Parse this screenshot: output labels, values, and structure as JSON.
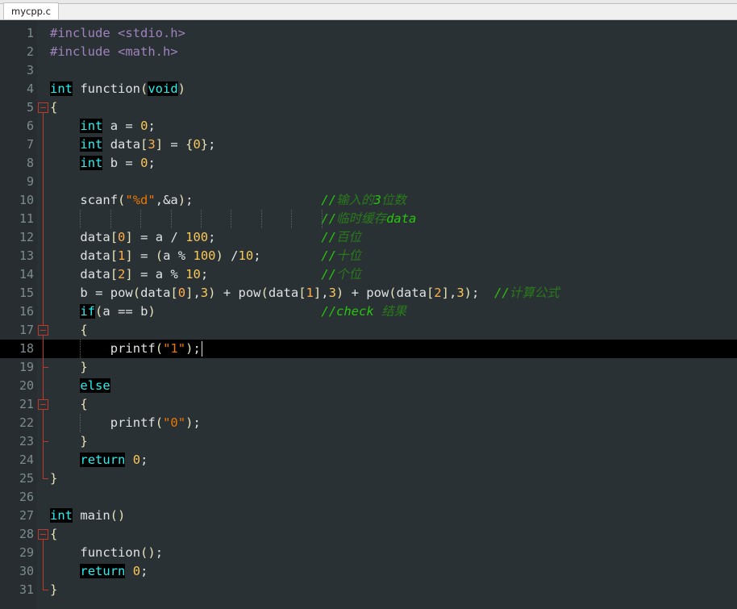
{
  "window": {
    "tab_label": "mycpp.c"
  },
  "editor": {
    "theme": {
      "background": "#293134",
      "gutter_background": "#272d30",
      "line_number_color": "#7d8c8f",
      "current_line_background": "#000000",
      "keyword_color": "#29f0f0",
      "keyword_background": "#000000",
      "string_color": "#ec7600",
      "number_color": "#f9c859",
      "comment_color": "#2a7a1c",
      "bracket_color": "#e8e2b7",
      "text_color": "#e0e2e4",
      "preprocessor_color": "#a082bd",
      "fold_marker_color": "#c0392b"
    },
    "current_line": 18,
    "total_lines": 31,
    "lines": [
      {
        "n": 1,
        "text": "#include <stdio.h>"
      },
      {
        "n": 2,
        "text": "#include <math.h>"
      },
      {
        "n": 3,
        "text": ""
      },
      {
        "n": 4,
        "text": "int function(void)"
      },
      {
        "n": 5,
        "text": "{"
      },
      {
        "n": 6,
        "text": "    int a = 0;"
      },
      {
        "n": 7,
        "text": "    int data[3] = {0};"
      },
      {
        "n": 8,
        "text": "    int b = 0;"
      },
      {
        "n": 9,
        "text": ""
      },
      {
        "n": 10,
        "text": "    scanf(\"%d\",&a);                 //输入的3位数"
      },
      {
        "n": 11,
        "text": "                                    //临时缓存data"
      },
      {
        "n": 12,
        "text": "    data[0] = a / 100;              //百位"
      },
      {
        "n": 13,
        "text": "    data[1] = (a % 100) /10;        //十位"
      },
      {
        "n": 14,
        "text": "    data[2] = a % 10;               //个位"
      },
      {
        "n": 15,
        "text": "    b = pow(data[0],3) + pow(data[1],3) + pow(data[2],3);  //计算公式"
      },
      {
        "n": 16,
        "text": "    if(a == b)                      //check 结果"
      },
      {
        "n": 17,
        "text": "    {"
      },
      {
        "n": 18,
        "text": "        printf(\"1\");"
      },
      {
        "n": 19,
        "text": "    }"
      },
      {
        "n": 20,
        "text": "    else"
      },
      {
        "n": 21,
        "text": "    {"
      },
      {
        "n": 22,
        "text": "        printf(\"0\");"
      },
      {
        "n": 23,
        "text": "    }"
      },
      {
        "n": 24,
        "text": "    return 0;"
      },
      {
        "n": 25,
        "text": "}"
      },
      {
        "n": 26,
        "text": ""
      },
      {
        "n": 27,
        "text": "int main()"
      },
      {
        "n": 28,
        "text": "{"
      },
      {
        "n": 29,
        "text": "    function();"
      },
      {
        "n": 30,
        "text": "    return 0;"
      },
      {
        "n": 31,
        "text": "}"
      }
    ],
    "comments": {
      "line10": "//输入的3位数",
      "line11": "//临时缓存data",
      "line12": "//百位",
      "line13": "//十位",
      "line14": "//个位",
      "line15": "//计算公式",
      "line16": "//check 结果"
    },
    "keywords_highlighted": [
      "int",
      "void",
      "if",
      "else",
      "return"
    ],
    "fold_markers": [
      {
        "line": 5,
        "state": "expanded"
      },
      {
        "line": 17,
        "state": "expanded"
      },
      {
        "line": 21,
        "state": "expanded"
      },
      {
        "line": 28,
        "state": "expanded"
      }
    ]
  }
}
